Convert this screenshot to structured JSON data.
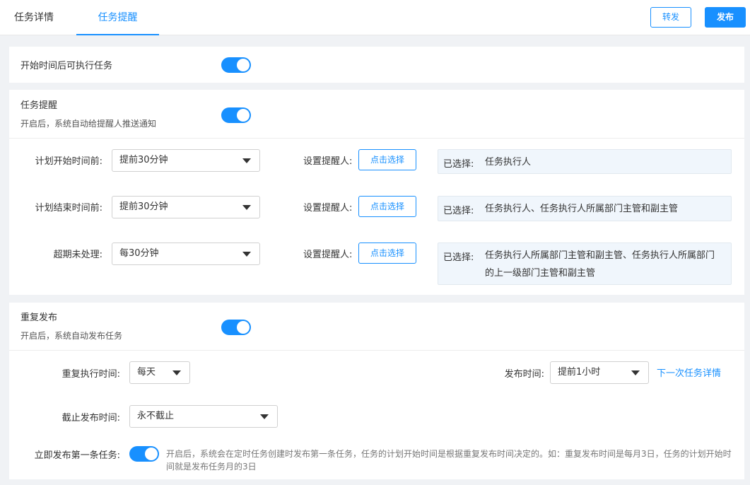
{
  "tabs": {
    "detail": "任务详情",
    "remind": "任务提醒"
  },
  "actions": {
    "forward": "转发",
    "publish": "发布"
  },
  "start_exec": {
    "label": "开始时间后可执行任务",
    "enabled": true
  },
  "task_remind": {
    "title": "任务提醒",
    "desc": "开启后，系统自动给提醒人推送通知",
    "enabled": true,
    "rows": [
      {
        "label": "计划开始时间前:",
        "option": "提前30分钟",
        "set_label": "设置提醒人:",
        "pick": "点击选择",
        "chosen_label": "已选择:",
        "chosen": "任务执行人"
      },
      {
        "label": "计划结束时间前:",
        "option": "提前30分钟",
        "set_label": "设置提醒人:",
        "pick": "点击选择",
        "chosen_label": "已选择:",
        "chosen": "任务执行人、任务执行人所属部门主管和副主管"
      },
      {
        "label": "超期未处理:",
        "option": "每30分钟",
        "set_label": "设置提醒人:",
        "pick": "点击选择",
        "chosen_label": "已选择:",
        "chosen": "任务执行人所属部门主管和副主管、任务执行人所属部门的上一级部门主管和副主管"
      }
    ]
  },
  "repeat": {
    "title": "重复发布",
    "desc": "开启后，系统自动发布任务",
    "enabled": true,
    "exec_time_label": "重复执行时间:",
    "exec_time_value": "每天",
    "publish_time_label": "发布时间:",
    "publish_time_value": "提前1小时",
    "next_link": "下一次任务详情",
    "end_label": "截止发布时间:",
    "end_value": "永不截止",
    "first_label": "立即发布第一条任务:",
    "first_enabled": true,
    "first_note": "开启后，系统会在定时任务创建时发布第一条任务，任务的计划开始时间是根据重复发布时间决定的。如：重复发布时间是每月3日，任务的计划开始时间就是发布任务月的3日"
  }
}
